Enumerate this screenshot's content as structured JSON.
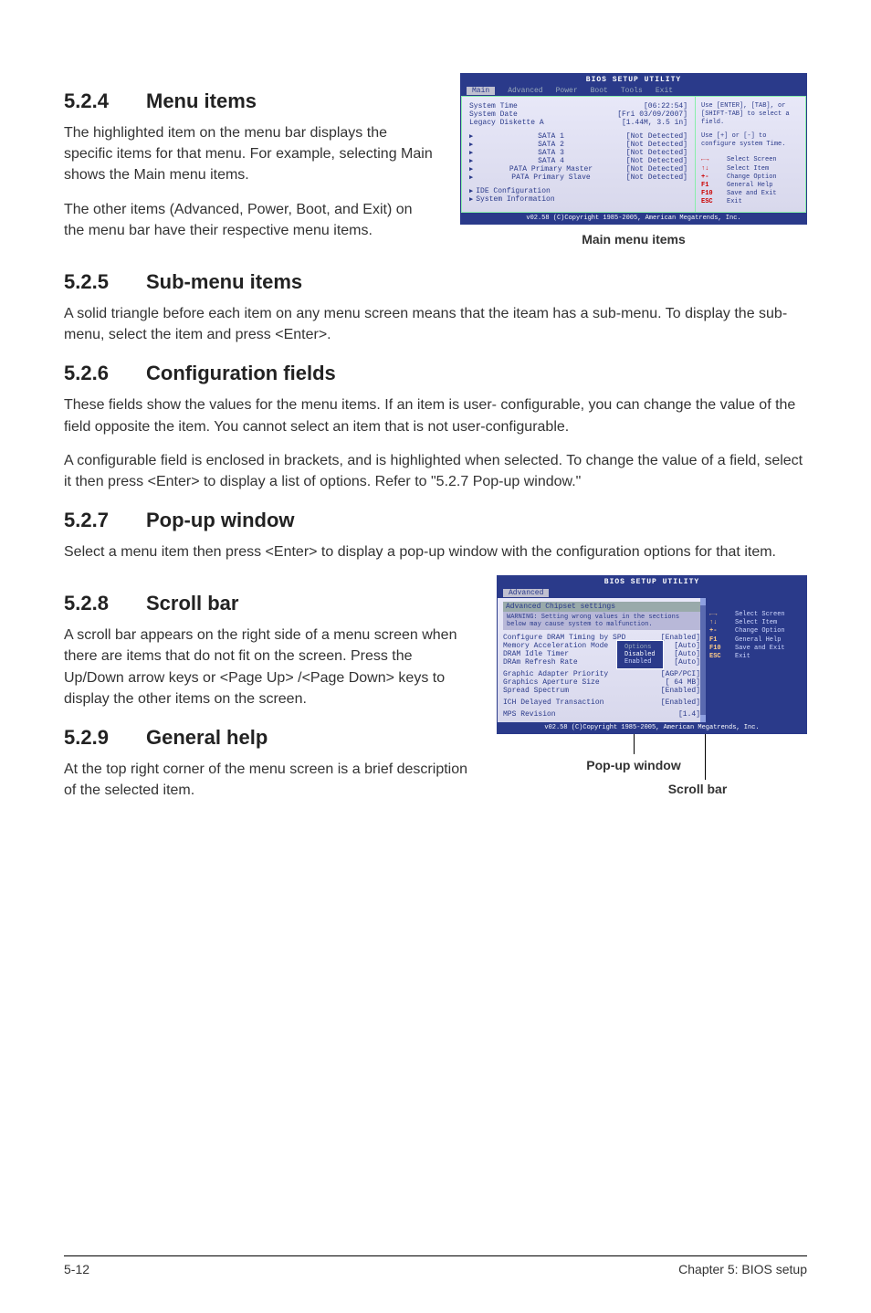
{
  "sections": {
    "s524": {
      "num": "5.2.4",
      "title": "Menu items",
      "p1": "The highlighted item on the menu bar displays the specific items for that menu. For example, selecting Main shows the Main menu items.",
      "p2": "The other items (Advanced, Power, Boot, and Exit) on the menu bar have their respective menu items."
    },
    "s525": {
      "num": "5.2.5",
      "title": "Sub-menu items",
      "p1": "A solid triangle before each item on any menu screen means that the iteam has a sub-menu. To display the sub-menu, select the item and press <Enter>."
    },
    "s526": {
      "num": "5.2.6",
      "title": "Configuration fields",
      "p1": "These fields show the values for the menu items. If an item is user- configurable, you can change the value of the field opposite the item. You cannot select an item that is not user-configurable.",
      "p2": "A configurable field is enclosed in brackets, and is highlighted when selected. To change the value of a field, select it then press <Enter> to display a list of options. Refer to \"5.2.7 Pop-up window.\""
    },
    "s527": {
      "num": "5.2.7",
      "title": "Pop-up window",
      "p1": "Select a menu item then press <Enter> to display a pop-up window with the configuration options for that item."
    },
    "s528": {
      "num": "5.2.8",
      "title": "Scroll bar",
      "p1": "A scroll bar appears on the right side of a menu screen when there are items that do not fit on the screen. Press the Up/Down arrow keys or <Page Up> /<Page Down> keys to display the other items on the screen."
    },
    "s529": {
      "num": "5.2.9",
      "title": "General help",
      "p1": "At the top right corner of the menu screen is a brief description of the selected item."
    }
  },
  "bios1": {
    "title": "BIOS SETUP UTILITY",
    "menu": [
      "Main",
      "Advanced",
      "Power",
      "Boot",
      "Tools",
      "Exit"
    ],
    "rows": [
      {
        "label": "System Time",
        "val": "[06:22:54]"
      },
      {
        "label": "System Date",
        "val": "[Fri 03/09/2007]"
      },
      {
        "label": "Legacy Diskette A",
        "val": "[1.44M, 3.5 in]"
      }
    ],
    "sub": [
      {
        "label": "SATA 1",
        "val": "[Not Detected]"
      },
      {
        "label": "SATA 2",
        "val": "[Not Detected]"
      },
      {
        "label": "SATA 3",
        "val": "[Not Detected]"
      },
      {
        "label": "SATA 4",
        "val": "[Not Detected]"
      },
      {
        "label": "PATA Primary Master",
        "val": "[Not Detected]"
      },
      {
        "label": "PATA Primary Slave",
        "val": "[Not Detected]"
      }
    ],
    "sub2": [
      {
        "label": "IDE Configuration"
      },
      {
        "label": "System Information"
      }
    ],
    "help1": "Use [ENTER], [TAB], or [SHIFT-TAB] to select a field.",
    "help2": "Use [+] or [-] to configure system Time.",
    "keys": [
      {
        "k": "←→",
        "t": "Select Screen"
      },
      {
        "k": "↑↓",
        "t": "Select Item"
      },
      {
        "k": "+-",
        "t": "Change Option"
      },
      {
        "k": "F1",
        "t": "General Help"
      },
      {
        "k": "F10",
        "t": "Save and Exit"
      },
      {
        "k": "ESC",
        "t": "Exit"
      }
    ],
    "foot": "v02.58 (C)Copyright 1985-2005, American Megatrends, Inc.",
    "caption": "Main menu items"
  },
  "bios2": {
    "title": "BIOS SETUP UTILITY",
    "tab": "Advanced",
    "header": "Advanced Chipset settings",
    "warn": "WARNING: Setting wrong values in the sections below may cause system to malfunction.",
    "rows": [
      {
        "label": "Configure DRAM Timing by SPD",
        "val": "[Enabled]"
      },
      {
        "label": "Memory Acceleration Mode",
        "val": "[Auto]"
      },
      {
        "label": "DRAM Idle Timer",
        "val": "[Auto]"
      },
      {
        "label": "DRAm Refresh Rate",
        "val": "[Auto]"
      },
      {
        "label": "Graphic Adapter Priority",
        "val": "[AGP/PCI]"
      },
      {
        "label": "Graphics Aperture Size",
        "val": "[ 64 MB]"
      },
      {
        "label": "Spread Spectrum",
        "val": "[Enabled]"
      },
      {
        "label": "ICH Delayed Transaction",
        "val": "[Enabled]"
      },
      {
        "label": "MPS Revision",
        "val": "[1.4]"
      }
    ],
    "popup": {
      "title": "Options",
      "opt1": "Disabled",
      "opt2": "Enabled"
    },
    "keys": [
      {
        "k": "←→",
        "t": "Select Screen"
      },
      {
        "k": "↑↓",
        "t": "Select Item"
      },
      {
        "k": "+-",
        "t": "Change Option"
      },
      {
        "k": "F1",
        "t": "General Help"
      },
      {
        "k": "F10",
        "t": "Save and Exit"
      },
      {
        "k": "ESC",
        "t": "Exit"
      }
    ],
    "foot": "v02.58 (C)Copyright 1985-2005, American Megatrends, Inc.",
    "ann_popup": "Pop-up window",
    "ann_scroll": "Scroll bar"
  },
  "footer": {
    "left": "5-12",
    "right": "Chapter 5: BIOS setup"
  }
}
